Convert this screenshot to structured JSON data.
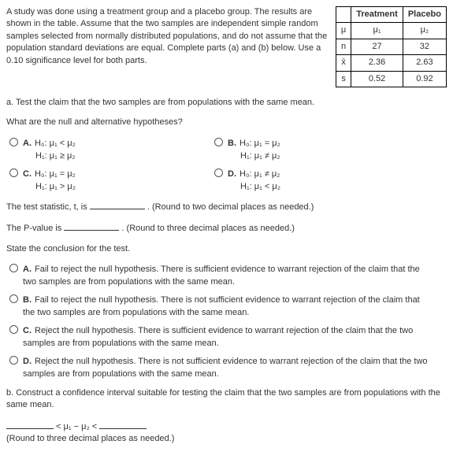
{
  "intro": "A study was done using a treatment group and a placebo group. The results are shown in the table. Assume that the two samples are independent simple random samples selected from normally distributed populations, and do not assume that the population standard deviations are equal. Complete parts (a) and (b) below. Use a 0.10 significance level for both parts.",
  "table": {
    "hdr_treatment": "Treatment",
    "hdr_placebo": "Placebo",
    "row_mu": "μ",
    "mu1": "μ₁",
    "mu2": "μ₂",
    "row_n": "n",
    "n1": "27",
    "n2": "32",
    "row_xbar": "x̄",
    "x1": "2.36",
    "x2": "2.63",
    "row_s": "s",
    "s1": "0.52",
    "s2": "0.92"
  },
  "a_prompt": "a. Test the claim that the two samples are from populations with the same mean.",
  "hyp_prompt": "What are the null and alternative hypotheses?",
  "optA": {
    "label": "A.",
    "h0": "H₀: μ₁ < μ₂",
    "h1": "H₁: μ₁ ≥ μ₂"
  },
  "optB": {
    "label": "B.",
    "h0": "H₀: μ₁ = μ₂",
    "h1": "H₁: μ₁ ≠ μ₂"
  },
  "optC": {
    "label": "C.",
    "h0": "H₀: μ₁ = μ₂",
    "h1": "H₁: μ₁ > μ₂"
  },
  "optD": {
    "label": "D.",
    "h0": "H₀: μ₁ ≠ μ₂",
    "h1": "H₁: μ₁ < μ₂"
  },
  "tstat_pre": "The test statistic, t, is",
  "tstat_hint": ". (Round to two decimal places as needed.)",
  "pval_pre": "The P-value is",
  "pval_hint": ". (Round to three decimal places as needed.)",
  "concl_prompt": "State the conclusion for the test.",
  "cA": {
    "label": "A.",
    "text": "Fail to reject the null hypothesis. There is sufficient evidence to warrant rejection of the claim that the two samples are from populations with the same mean."
  },
  "cB": {
    "label": "B.",
    "text": "Fail to reject the null hypothesis. There is not sufficient evidence to warrant rejection of the claim that the two samples are from populations with the same mean."
  },
  "cC": {
    "label": "C.",
    "text": "Reject the null hypothesis. There is sufficient evidence to warrant rejection of the claim that the two samples are from populations with the same mean."
  },
  "cD": {
    "label": "D.",
    "text": "Reject the null hypothesis. There is not sufficient evidence to warrant rejection of the claim that the two samples are from populations with the same mean."
  },
  "b_prompt": "b. Construct a confidence interval suitable for testing the claim that the two samples are from populations with the same mean.",
  "ci_mid": "< μ₁ − μ₂ <",
  "ci_hint": "(Round to three decimal places as needed.)"
}
